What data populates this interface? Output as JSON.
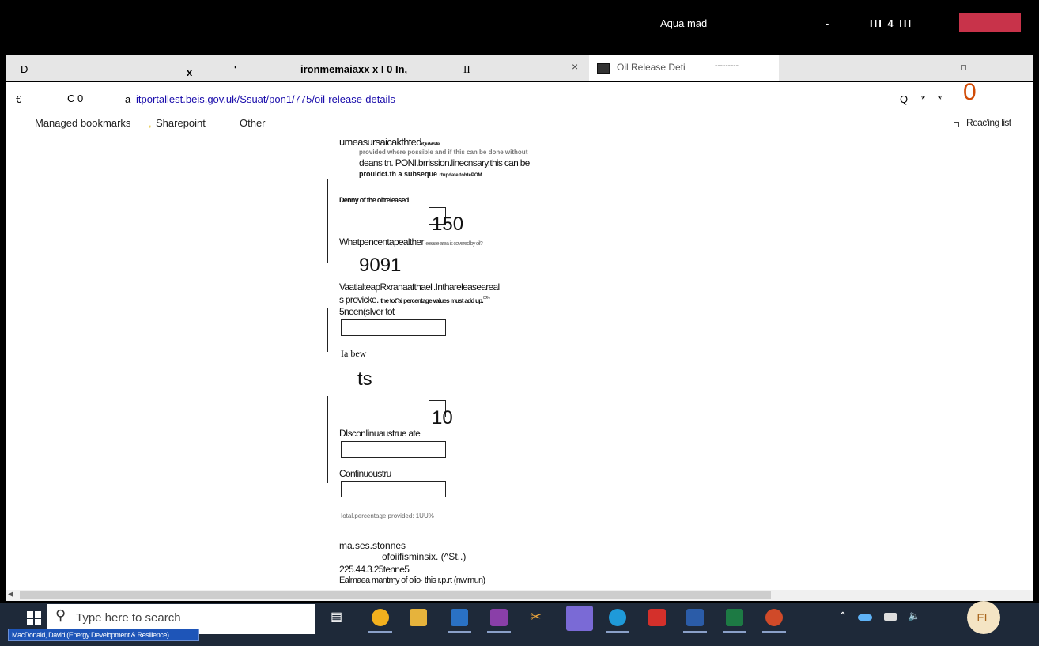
{
  "window": {
    "title": "Aqua mad",
    "minimize_label": "-",
    "restore_label": "III 4 III"
  },
  "tabs": [
    {
      "label": "D"
    },
    {
      "label": "x"
    },
    {
      "label": "'"
    },
    {
      "label": "ironmemaiaxx x I 0 In,"
    },
    {
      "label": "II"
    },
    {
      "label": "Oil Release Deti"
    }
  ],
  "tab_close_label": "×",
  "tab_dots": "---------",
  "address": {
    "back": "€",
    "refresh": "C 0",
    "prefix": "a",
    "url": "itportallest.beis.gov.uk/Ssuat/pon1/775/oil-release-details",
    "right_icons": [
      "Q",
      "*",
      "*"
    ],
    "profile": "0"
  },
  "bookmarks": {
    "items": [
      "Managed bookmarks",
      ",",
      "Sharepoint",
      "Other"
    ],
    "reading_list": "Reac'ing list"
  },
  "form": {
    "intro_line1": "umeasursaicakthted",
    "intro_line1_small": "rQuilvitsite",
    "intro_line2": "provided where possible and if this can be done without",
    "intro_line3": "deans tn. PONI.brrission.linecnsary.this can be",
    "intro_line4": "prouldct.th a subseque",
    "intro_line4b": "rtupdate tohtePOM.",
    "density_label": "Denny of the oltreleased",
    "density_value": "150",
    "percent_q_label": "Whatpencentapealther",
    "percent_q_hint": "elease area is covered by oil?",
    "percent_value": "9091",
    "variation_label": "VaatialteapRxranaafthaell.Inthareleaseareal",
    "provide_label": "s provicke.",
    "provide_note": "the tot°al percentage values must add up.",
    "provide_note_sup": "00%",
    "silver_label": "5neen(sIver tot",
    "ia_bew_label": "Ia bew",
    "ts_value": "ts",
    "disc_value": "10",
    "disc_label": "DIsconIinuaustrue ate",
    "continuous_label": "Continuoustru",
    "total_percentage": "Iotal.percentage provided: 1UU%",
    "mass_label": "ma.ses.stonnes",
    "mass_sub": "ofoiifisminsix. (^St..)",
    "mass_value": "225.44.3.25tenne5",
    "estimate_label": "Ealmaea mantmy of olio· this r.p.rt (nwimun)"
  },
  "taskbar": {
    "search_placeholder": "Type here to search",
    "user_name": "MacDonald, David (Energy Development & Resilience)",
    "avatar_initials": "EL"
  },
  "colors": {
    "close_button": "#c8334a",
    "link": "#1a0dab",
    "profile": "#d14b06",
    "taskbar": "#1e2939"
  }
}
